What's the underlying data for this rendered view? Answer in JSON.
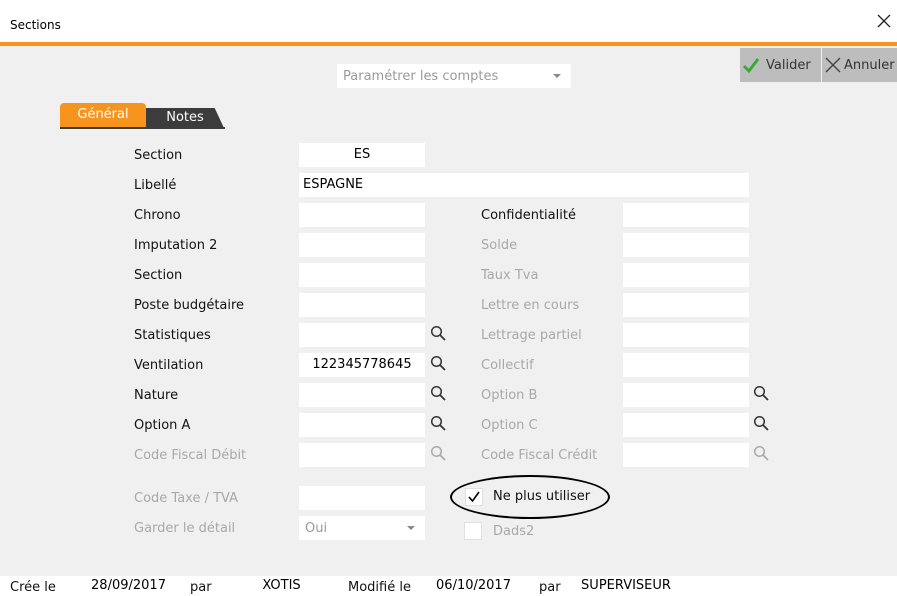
{
  "window": {
    "title": "Sections",
    "close_icon": "close-icon"
  },
  "toolbar": {
    "valider_label": "Valider",
    "annuler_label": "Annuler",
    "valider_icon_color": "#3aaa35",
    "accent_color": "#f7941d"
  },
  "account_dropdown": {
    "placeholder": "Paramétrer les comptes"
  },
  "tabs": [
    {
      "label": "Général",
      "active": true
    },
    {
      "label": "Notes",
      "active": false
    }
  ],
  "form": {
    "section": {
      "label": "Section",
      "value": "ES"
    },
    "libelle": {
      "label": "Libellé",
      "value": "ESPAGNE"
    },
    "chrono": {
      "label": "Chrono",
      "value": ""
    },
    "imputation2": {
      "label": "Imputation 2",
      "value": ""
    },
    "section2": {
      "label": "Section",
      "value": ""
    },
    "poste_budgetaire": {
      "label": "Poste budgétaire",
      "value": ""
    },
    "statistiques": {
      "label": "Statistiques",
      "value": ""
    },
    "ventilation": {
      "label": "Ventilation",
      "value": "122345778645"
    },
    "nature": {
      "label": "Nature",
      "value": ""
    },
    "option_a": {
      "label": "Option A",
      "value": ""
    },
    "code_fiscal_debit": {
      "label": "Code Fiscal Débit",
      "value": ""
    },
    "code_taxe_tva": {
      "label": "Code Taxe / TVA",
      "value": ""
    },
    "garder_detail": {
      "label": "Garder le détail",
      "value": "Oui"
    },
    "confidentialite": {
      "label": "Confidentialité",
      "value": ""
    },
    "solde": {
      "label": "Solde",
      "value": ""
    },
    "taux_tva": {
      "label": "Taux Tva",
      "value": ""
    },
    "lettre_en_cours": {
      "label": "Lettre en cours",
      "value": ""
    },
    "lettrage_partiel": {
      "label": "Lettrage partiel",
      "value": ""
    },
    "collectif": {
      "label": "Collectif",
      "value": ""
    },
    "option_b": {
      "label": "Option B",
      "value": ""
    },
    "option_c": {
      "label": "Option C",
      "value": ""
    },
    "code_fiscal_credit": {
      "label": "Code Fiscal Crédit",
      "value": ""
    },
    "ne_plus_utiliser": {
      "label": "Ne plus utiliser",
      "checked": true
    },
    "dads2": {
      "label": "Dads2",
      "checked": false
    }
  },
  "footer": {
    "cree_le_label": "Crée le",
    "cree_le_value": "28/09/2017",
    "par1_label": "par",
    "par1_value": "XOTIS",
    "modifie_le_label": "Modifié le",
    "modifie_le_value": "06/10/2017",
    "par2_label": "par",
    "par2_value": "SUPERVISEUR"
  }
}
